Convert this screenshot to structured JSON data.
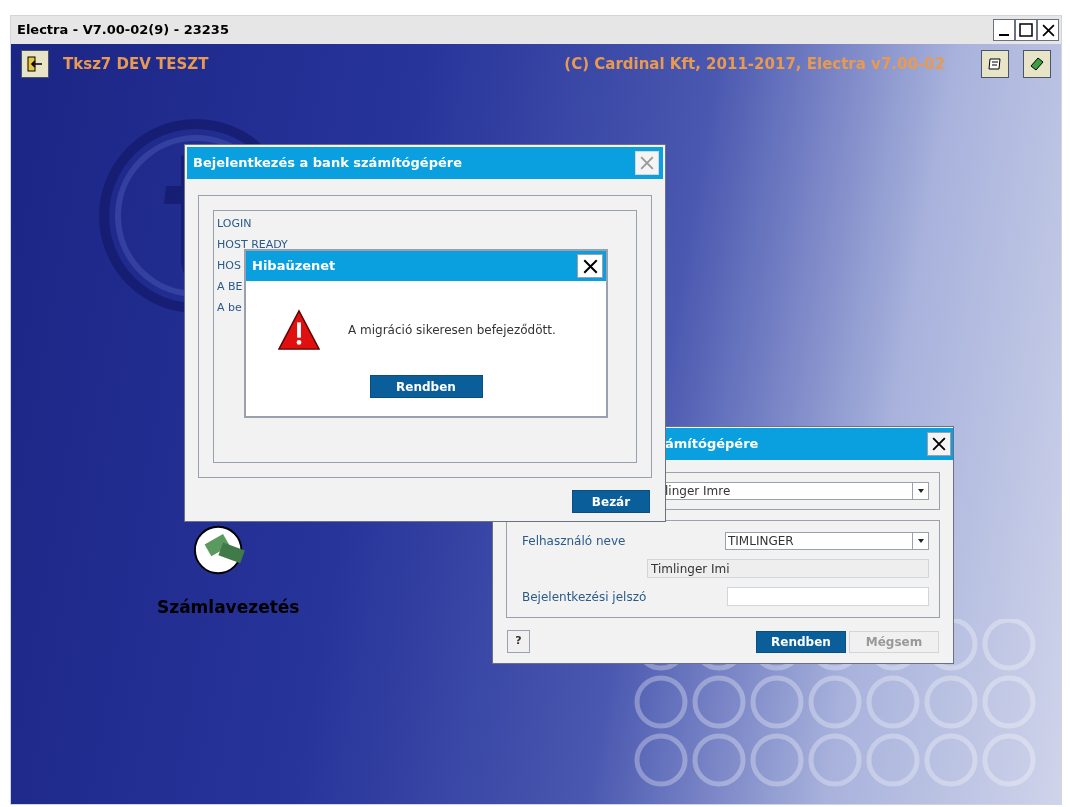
{
  "window": {
    "title": "Electra - V7.00-02(9) - 23235"
  },
  "header": {
    "title": "Tksz7 DEV TESZT",
    "copyright": "(C) Cardinal Kft, 2011-2017, Electra v7.00-02"
  },
  "desktop_items": [
    {
      "label": "Számlavezetés"
    }
  ],
  "login_dialog": {
    "title_visible": "ámítógépére",
    "bank_value": "linger Imre",
    "user_label": "Felhasználó neve",
    "user_value": "TIMLINGER",
    "full_name": "Timlinger Imi",
    "password_label": "Bejelentkezési jelszó",
    "help": "?",
    "buttons": [
      {
        "label": "Rendben",
        "disabled": false
      },
      {
        "label": "Mégsem",
        "disabled": true
      }
    ]
  },
  "progress_dialog": {
    "title": "Bejelentkezés a bank számítógépére",
    "log": [
      "LOGIN",
      "HOST READY",
      "HOS",
      "A BE",
      "A be"
    ],
    "button": "Bezár"
  },
  "error_dialog": {
    "title": "Hibaüzenet",
    "message": "A migráció sikeresen befejeződött.",
    "button": "Rendben"
  }
}
